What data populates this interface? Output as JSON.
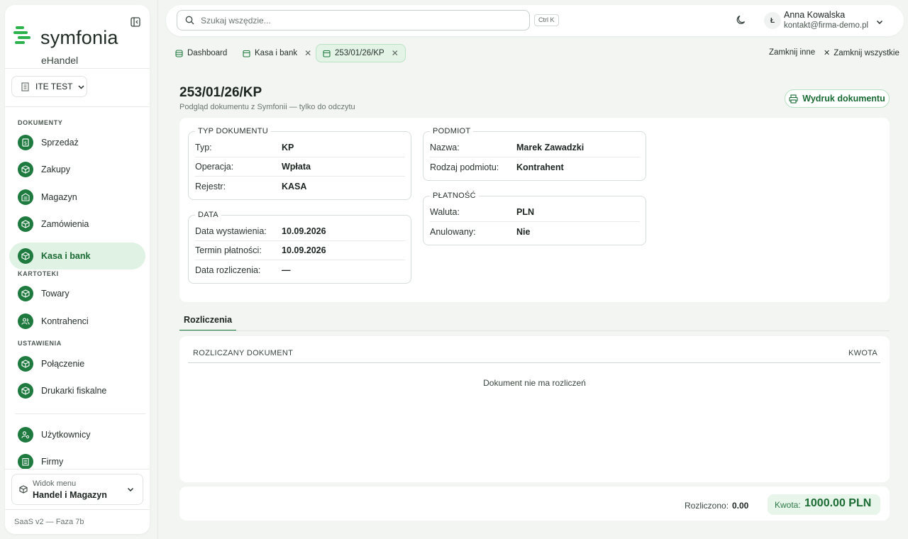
{
  "sidebar": {
    "logo_text": "symfonia",
    "logo_sub": "eHandel",
    "company": "ITE TEST",
    "sections": {
      "documents": "DOKUMENTY",
      "files": "KARTOTEKI",
      "settings": "USTAWIENIA"
    },
    "items": [
      {
        "label": "Sprzedaż",
        "icon": "invoice-icon"
      },
      {
        "label": "Zakupy",
        "icon": "box-icon"
      },
      {
        "label": "Magazyn",
        "icon": "warehouse-icon"
      },
      {
        "label": "Zamówienia",
        "icon": "box-icon"
      },
      {
        "label": "Kasa i bank",
        "icon": "box-icon",
        "active": true
      },
      {
        "label": "Towary",
        "icon": "box-icon"
      },
      {
        "label": "Kontrahenci",
        "icon": "users-icon"
      },
      {
        "label": "Połączenie",
        "icon": "box-icon"
      },
      {
        "label": "Drukarki fiskalne",
        "icon": "box-icon"
      },
      {
        "label": "Użytkownicy",
        "icon": "user-key-icon"
      },
      {
        "label": "Firmy",
        "icon": "building-icon"
      }
    ],
    "menu_view_caption": "Widok menu",
    "menu_view_value": "Handel i Magazyn",
    "version": "SaaS v2 — Faza 7b"
  },
  "topbar": {
    "search_placeholder": "Szukaj wszędzie...",
    "shortcut": "Ctrl K",
    "user_initial": "Ł",
    "user_name": "Anna Kowalska",
    "user_email": "kontakt@firma-demo.pl"
  },
  "tabs": [
    {
      "label": "Dashboard"
    },
    {
      "label": "Kasa i bank"
    },
    {
      "label": "253/01/26/KP",
      "active": true
    }
  ],
  "tab_actions": {
    "close_others": "Zamknij inne",
    "close_all": "Zamknij wszystkie"
  },
  "document": {
    "title": "253/01/26/KP",
    "subtitle": "Podgląd dokumentu z Symfonii — tylko do odczytu",
    "print_label": "Wydruk dokumentu",
    "type_section": {
      "legend": "TYP DOKUMENTU",
      "rows": [
        {
          "key": "Typ:",
          "value": "KP"
        },
        {
          "key": "Operacja:",
          "value": "Wpłata"
        },
        {
          "key": "Rejestr:",
          "value": "KASA"
        }
      ]
    },
    "date_section": {
      "legend": "DATA",
      "rows": [
        {
          "key": "Data wystawienia:",
          "value": "10.09.2026"
        },
        {
          "key": "Termin płatności:",
          "value": "10.09.2026"
        },
        {
          "key": "Data rozliczenia:",
          "value": "—"
        }
      ]
    },
    "entity_section": {
      "legend": "PODMIOT",
      "rows": [
        {
          "key": "Nazwa:",
          "value": "Marek Zawadzki"
        },
        {
          "key": "Rodzaj podmiotu:",
          "value": "Kontrahent"
        }
      ]
    },
    "payment_section": {
      "legend": "PŁATNOŚĆ",
      "rows": [
        {
          "key": "Waluta:",
          "value": "PLN"
        },
        {
          "key": "Anulowany:",
          "value": "Nie"
        }
      ]
    }
  },
  "settlements": {
    "tab_label": "Rozliczenia",
    "col_document": "ROZLICZANY DOKUMENT",
    "col_amount": "KWOTA",
    "empty_text": "Dokument nie ma rozliczeń",
    "settled_label": "Rozliczono:",
    "settled_value": "0.00",
    "amount_label": "Kwota:",
    "amount_value": "1000.00 PLN"
  },
  "colors": {
    "accent": "#1e7a3f",
    "accent_light": "#dff2e4"
  }
}
